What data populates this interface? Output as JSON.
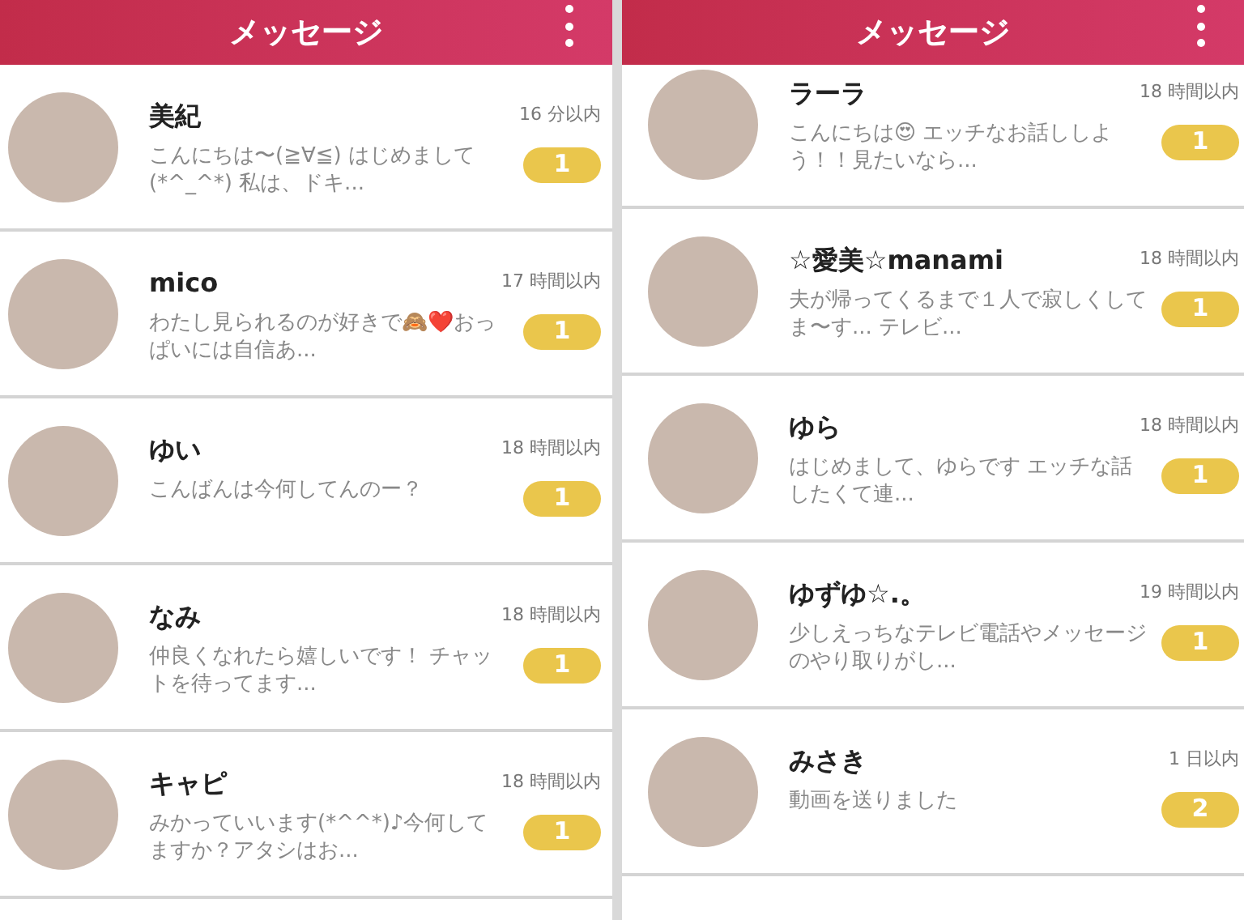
{
  "panels": [
    {
      "title": "メッセージ",
      "conversations": [
        {
          "name": "美紀",
          "time": "16 分以内",
          "message": "こんにちは〜(≧∀≦) はじめまして(*^_^*) 私は、ドキ...",
          "unread": "1"
        },
        {
          "name": "mico",
          "time": "17 時間以内",
          "message": "わたし見られるのが好きで🙈❤️おっぱいには自信あ...",
          "unread": "1"
        },
        {
          "name": "ゆい",
          "time": "18 時間以内",
          "message": "こんばんは今何してんのー？",
          "unread": "1"
        },
        {
          "name": "なみ",
          "time": "18 時間以内",
          "message": "仲良くなれたら嬉しいです！ チャットを待ってます...",
          "unread": "1"
        },
        {
          "name": "キャピ",
          "time": "18 時間以内",
          "message": "みかっていいます(*^^*)♪今何してますか？アタシはお...",
          "unread": "1"
        }
      ]
    },
    {
      "title": "メッセージ",
      "conversations": [
        {
          "name": "ラーラ",
          "time": "18 時間以内",
          "message": "こんにちは😍 エッチなお話ししよう！！見たいなら...",
          "unread": "1"
        },
        {
          "name": "☆愛美☆manami",
          "time": "18 時間以内",
          "message": "夫が帰ってくるまで１人で寂しくしてま〜す... テレビ...",
          "unread": "1"
        },
        {
          "name": "ゆら",
          "time": "18 時間以内",
          "message": "はじめまして、ゆらです エッチな話したくて連...",
          "unread": "1"
        },
        {
          "name": "ゆずゆ☆.。",
          "time": "19 時間以内",
          "message": "少しえっちなテレビ電話やメッセージのやり取りがし...",
          "unread": "1"
        },
        {
          "name": "みさき",
          "time": "1 日以内",
          "message": "動画を送りました",
          "unread": "2"
        }
      ]
    }
  ]
}
